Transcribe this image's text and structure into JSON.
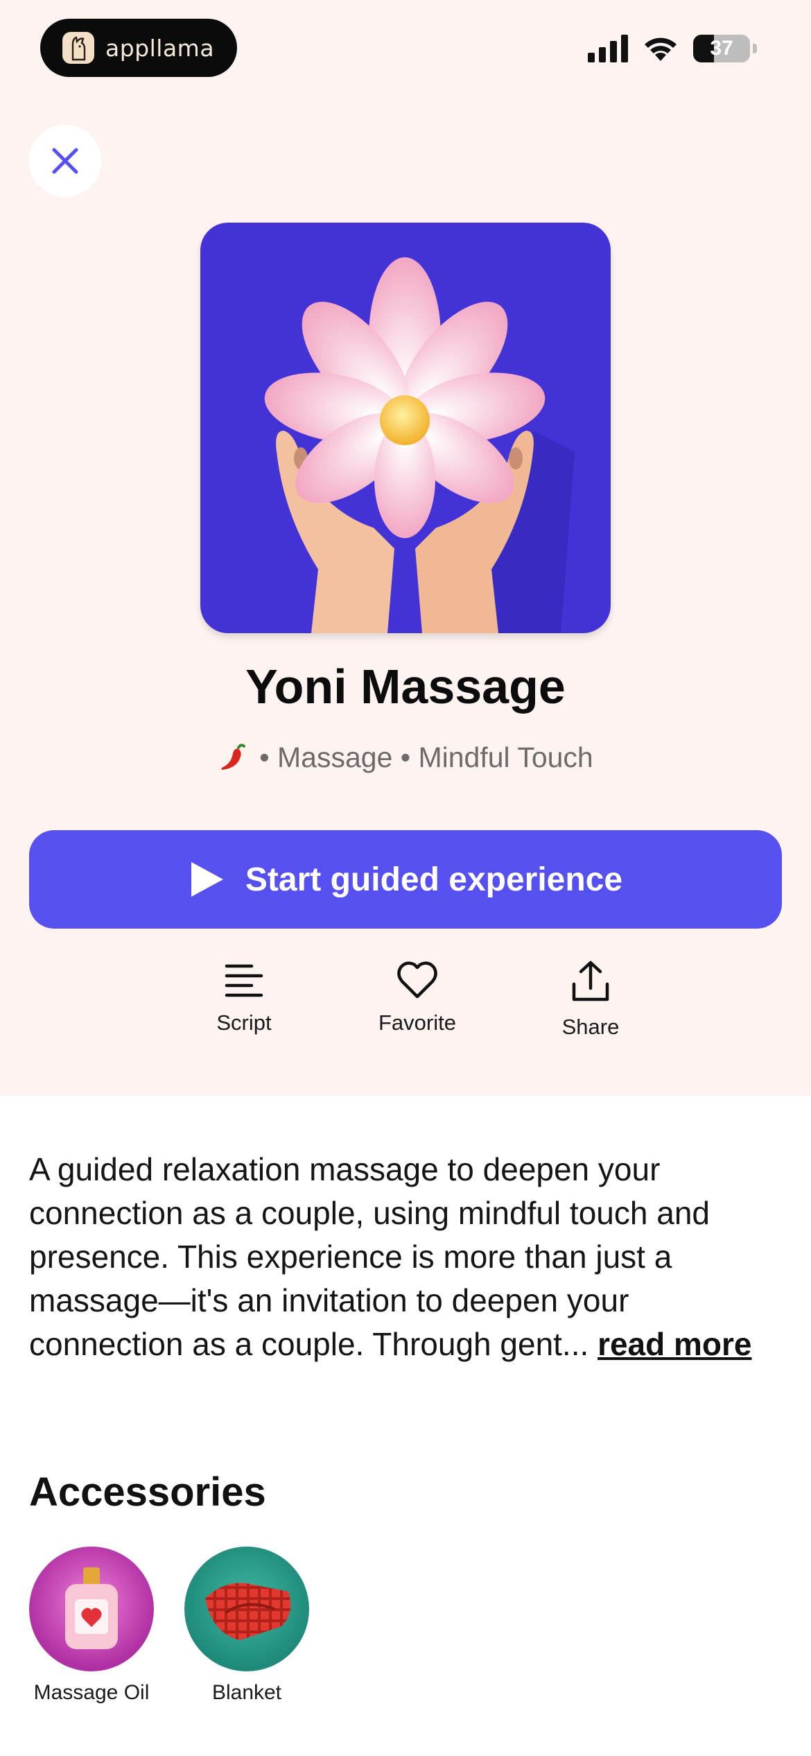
{
  "status_bar": {
    "brand": "appllama",
    "battery": "37"
  },
  "experience": {
    "title": "Yoni Massage",
    "spice_icon": "chili-pepper-icon",
    "category": "• Massage • Mindful Touch",
    "start_label": "Start guided experience"
  },
  "actions": {
    "script_label": "Script",
    "favorite_label": "Favorite",
    "share_label": "Share"
  },
  "description": {
    "text": "A guided relaxation massage to deepen your connection as a couple, using mindful touch and presence. This experience is more than just a massage—it's an invitation to deepen your connection as a couple. Through gent...",
    "read_more": "read more"
  },
  "accessories": {
    "title": "Accessories",
    "items": [
      {
        "label": "Massage Oil",
        "icon": "massage-oil-icon",
        "color": "#b02fa3"
      },
      {
        "label": "Blanket",
        "icon": "blanket-icon",
        "color": "#1f8a79"
      }
    ]
  },
  "colors": {
    "accent": "#5750f1",
    "hero_bg": "#4333d6",
    "top_bg": "#fdf3f1"
  }
}
